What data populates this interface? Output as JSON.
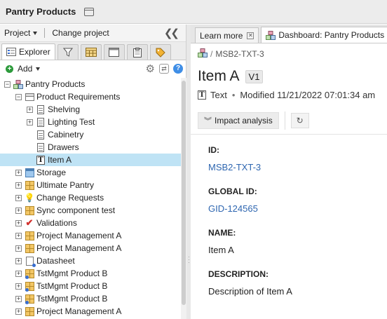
{
  "app": {
    "title": "Pantry Products"
  },
  "left": {
    "project_label": "Project",
    "change_project_label": "Change project",
    "explorer_tab": "Explorer",
    "add_label": "Add",
    "tree": [
      {
        "label": "Pantry Products",
        "level": 0,
        "expander": "minus",
        "icon": "product-icon"
      },
      {
        "label": "Product Requirements",
        "level": 1,
        "expander": "minus",
        "icon": "component-icon"
      },
      {
        "label": "Shelving",
        "level": 2,
        "expander": "plus",
        "icon": "document-icon"
      },
      {
        "label": "Lighting Test",
        "level": 2,
        "expander": "plus",
        "icon": "document-icon"
      },
      {
        "label": "Cabinetry",
        "level": 2,
        "expander": "none",
        "icon": "document-icon"
      },
      {
        "label": "Drawers",
        "level": 2,
        "expander": "none",
        "icon": "document-icon"
      },
      {
        "label": "Item A",
        "level": 2,
        "expander": "none",
        "icon": "text-icon",
        "selected": true
      },
      {
        "label": "Storage",
        "level": 1,
        "expander": "plus",
        "icon": "storage-icon"
      },
      {
        "label": "Ultimate Pantry",
        "level": 1,
        "expander": "plus",
        "icon": "grid-icon"
      },
      {
        "label": "Change Requests",
        "level": 1,
        "expander": "plus",
        "icon": "lightbulb-icon"
      },
      {
        "label": "Sync component test",
        "level": 1,
        "expander": "plus",
        "icon": "grid-icon"
      },
      {
        "label": "Validations",
        "level": 1,
        "expander": "plus",
        "icon": "checkmark-icon"
      },
      {
        "label": "Project Management A",
        "level": 1,
        "expander": "plus",
        "icon": "grid-icon"
      },
      {
        "label": "Project Management A",
        "level": 1,
        "expander": "plus",
        "icon": "grid-icon"
      },
      {
        "label": "Datasheet",
        "level": 1,
        "expander": "plus",
        "icon": "datasheet-icon"
      },
      {
        "label": "TstMgmt Product B",
        "level": 1,
        "expander": "plus",
        "icon": "grid-dot-icon"
      },
      {
        "label": "TstMgmt Product B",
        "level": 1,
        "expander": "plus",
        "icon": "grid-dot-icon"
      },
      {
        "label": "TstMgmt Product B",
        "level": 1,
        "expander": "plus",
        "icon": "grid-dot-icon"
      },
      {
        "label": "Project Management A",
        "level": 1,
        "expander": "plus",
        "icon": "grid-icon"
      }
    ]
  },
  "right": {
    "tabs": [
      {
        "label": "Learn more",
        "active": false
      },
      {
        "label": "Dashboard: Pantry Products",
        "active": true
      }
    ],
    "breadcrumb_code": "MSB2-TXT-3",
    "item_name": "Item A",
    "version": "V1",
    "item_type": "Text",
    "modified": "Modified 11/21/2022 07:01:34 am",
    "impact_label": "Impact analysis",
    "fields": [
      {
        "label": "ID:",
        "value": "MSB2-TXT-3",
        "link": true
      },
      {
        "label": "GLOBAL ID:",
        "value": "GID-124565",
        "link": true
      },
      {
        "label": "NAME:",
        "value": "Item A",
        "link": false
      },
      {
        "label": "DESCRIPTION:",
        "value": "Description of Item A",
        "link": false
      }
    ]
  }
}
